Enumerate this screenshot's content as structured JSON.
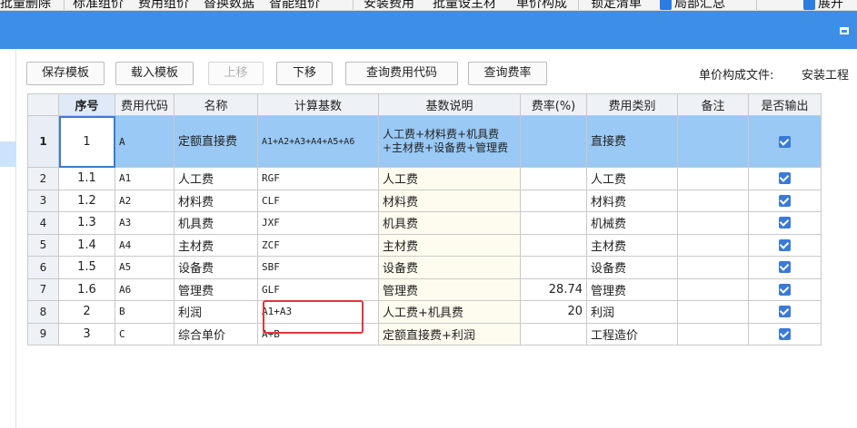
{
  "menubar": {
    "items": [
      "批量删除",
      "标准组价",
      "费用组价",
      "替换数据",
      "智能组价",
      "安装费用",
      "批量设主材",
      "单价构成",
      "锁定清单",
      "局部汇总",
      "展开"
    ]
  },
  "toolbar": {
    "buttons": [
      "保存模板",
      "载入模板",
      "上移",
      "下移",
      "查询费用代码",
      "查询费率"
    ],
    "file_label": "单价构成文件:",
    "file_value": "安装工程"
  },
  "table": {
    "headers": [
      "序号",
      "费用代码",
      "名称",
      "计算基数",
      "基数说明",
      "费率(%)",
      "费用类别",
      "备注",
      "是否输出"
    ],
    "rows": [
      {
        "rownum": "1",
        "seq": "1",
        "code": "A",
        "name": "定额直接费",
        "base": "A1+A2+A3+A4+A5+A6",
        "desc": "人工费+材料费+机具费+主材费+设备费+管理费",
        "rate": "",
        "category": "直接费",
        "note": "",
        "output": true
      },
      {
        "rownum": "2",
        "seq": "1.1",
        "code": "A1",
        "name": "人工费",
        "base": "RGF",
        "desc": "人工费",
        "rate": "",
        "category": "人工费",
        "note": "",
        "output": true
      },
      {
        "rownum": "3",
        "seq": "1.2",
        "code": "A2",
        "name": "材料费",
        "base": "CLF",
        "desc": "材料费",
        "rate": "",
        "category": "材料费",
        "note": "",
        "output": true
      },
      {
        "rownum": "4",
        "seq": "1.3",
        "code": "A3",
        "name": "机具费",
        "base": "JXF",
        "desc": "机具费",
        "rate": "",
        "category": "机械费",
        "note": "",
        "output": true
      },
      {
        "rownum": "5",
        "seq": "1.4",
        "code": "A4",
        "name": "主材费",
        "base": "ZCF",
        "desc": "主材费",
        "rate": "",
        "category": "主材费",
        "note": "",
        "output": true
      },
      {
        "rownum": "6",
        "seq": "1.5",
        "code": "A5",
        "name": "设备费",
        "base": "SBF",
        "desc": "设备费",
        "rate": "",
        "category": "设备费",
        "note": "",
        "output": true
      },
      {
        "rownum": "7",
        "seq": "1.6",
        "code": "A6",
        "name": "管理费",
        "base": "GLF",
        "desc": "管理费",
        "rate": "28.74",
        "category": "管理费",
        "note": "",
        "output": true
      },
      {
        "rownum": "8",
        "seq": "2",
        "code": "B",
        "name": "利润",
        "base": "A1+A3",
        "desc": "人工费+机具费",
        "rate": "20",
        "category": "利润",
        "note": "",
        "output": true
      },
      {
        "rownum": "9",
        "seq": "3",
        "code": "C",
        "name": "综合单价",
        "base": "A+B",
        "desc": "定额直接费+利润",
        "rate": "",
        "category": "工程造价",
        "note": "",
        "output": true
      }
    ]
  },
  "colors": {
    "title_bar": "#3c8ee6",
    "selected_row": "#99c9f4",
    "checkbox": "#3a7ad8",
    "highlight_box": "#e5343a"
  }
}
